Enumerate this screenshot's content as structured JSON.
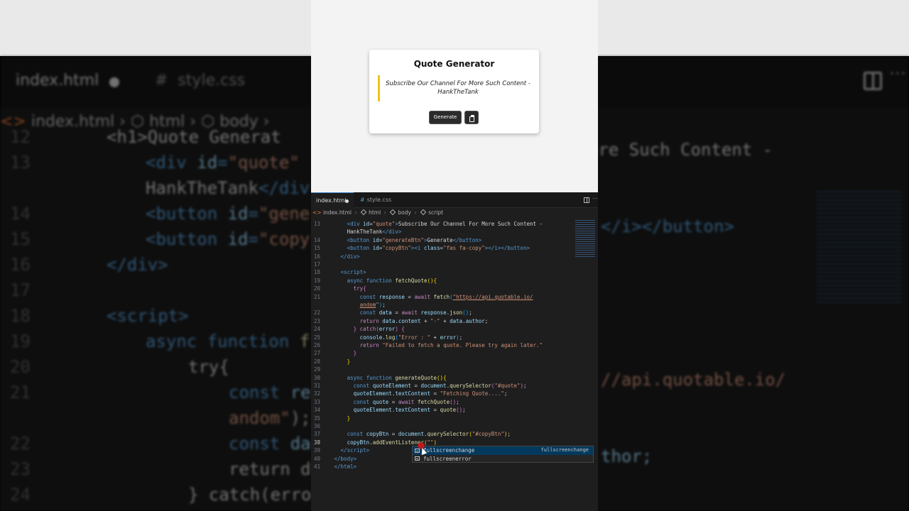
{
  "preview": {
    "title": "Quote Generator",
    "quote": "Subscribe Our Channel For More Such Content - HankTheTank",
    "generate_label": "Generate"
  },
  "editor": {
    "tabs": [
      {
        "label": "index.html",
        "modified": true
      },
      {
        "label": "style.css",
        "icon": "#"
      }
    ],
    "breadcrumb": [
      "index.html",
      "html",
      "body",
      "script"
    ],
    "current_line": 38,
    "lines": [
      {
        "n": 13,
        "html": "<span class=\"t-tag\">&lt;div</span> <span class=\"t-att\">id</span>=<span class=\"t-str\">\"quote\"</span><span class=\"t-tag\">&gt;</span><span class=\"t-txt\">Subscribe Our Channel For More Such Content -</span>",
        "indent": 5
      },
      {
        "n": null,
        "html": "<span class=\"t-txt\">HankTheTank</span><span class=\"t-tag\">&lt;/div&gt;</span>",
        "indent": 5
      },
      {
        "n": 14,
        "html": "<span class=\"t-tag\">&lt;button</span> <span class=\"t-att\">id</span>=<span class=\"t-str\">\"generateBtn\"</span><span class=\"t-tag\">&gt;</span><span class=\"t-txt\">Generate</span><span class=\"t-tag\">&lt;/button&gt;</span>",
        "indent": 5
      },
      {
        "n": 15,
        "html": "<span class=\"t-tag\">&lt;button</span> <span class=\"t-att\">id</span>=<span class=\"t-str\">\"copyBtn\"</span><span class=\"t-tag\">&gt;&lt;i</span> <span class=\"t-att\">class</span>=<span class=\"t-str\">\"fas fa-copy\"</span><span class=\"t-tag\">&gt;&lt;/i&gt;&lt;/button&gt;</span>",
        "indent": 5
      },
      {
        "n": 16,
        "html": "<span class=\"t-tag\">&lt;/div&gt;</span>",
        "indent": 3
      },
      {
        "n": 17,
        "html": "",
        "indent": 0
      },
      {
        "n": 18,
        "html": "<span class=\"t-tag\">&lt;script&gt;</span>",
        "indent": 3
      },
      {
        "n": 19,
        "html": "<span class=\"t-kw\">async</span> <span class=\"t-kw\">function</span> <span class=\"t-fn\">fetchQuote</span><span class=\"t-br\">()</span><span class=\"t-br\">{</span>",
        "indent": 5
      },
      {
        "n": 20,
        "html": "<span class=\"t-ctl\">try</span><span class=\"t-br2\">{</span>",
        "indent": 7
      },
      {
        "n": 21,
        "html": "<span class=\"t-kw\">const</span> <span class=\"t-var\">response</span> = <span class=\"t-ctl\">await</span> <span class=\"t-fn\">fetch</span><span class=\"t-br3\">(</span><span class=\"t-url\">\"https://api.quotable.io/</span>",
        "indent": 9
      },
      {
        "n": null,
        "html": "<span class=\"t-url\">andom</span><span class=\"t-str\">\"</span><span class=\"t-br3\">)</span>;",
        "indent": 9
      },
      {
        "n": 22,
        "html": "<span class=\"t-kw\">const</span> <span class=\"t-var\">data</span> = <span class=\"t-ctl\">await</span> <span class=\"t-var\">response</span>.<span class=\"t-fn\">json</span><span class=\"t-br3\">()</span>;",
        "indent": 9
      },
      {
        "n": 23,
        "html": "<span class=\"t-ctl\">return</span> <span class=\"t-var\">data</span>.<span class=\"t-var\">content</span> + <span class=\"t-str\">\"-\"</span> + <span class=\"t-var\">data</span>.<span class=\"t-var\">author</span>;",
        "indent": 9
      },
      {
        "n": 24,
        "html": "<span class=\"t-br2\">}</span> <span class=\"t-ctl\">catch</span><span class=\"t-br2\">(</span><span class=\"t-var\">error</span><span class=\"t-br2\">)</span> <span class=\"t-br2\">{</span>",
        "indent": 7
      },
      {
        "n": 25,
        "html": "<span class=\"t-var\">console</span>.<span class=\"t-fn\">log</span><span class=\"t-br3\">(</span><span class=\"t-str\">\"Error : \"</span> + <span class=\"t-var\">error</span><span class=\"t-br3\">)</span>;",
        "indent": 9
      },
      {
        "n": 26,
        "html": "<span class=\"t-ctl\">return</span> <span class=\"t-str\">\"Failed to fetch a quote. Please try again later.\"</span>",
        "indent": 9
      },
      {
        "n": 27,
        "html": "<span class=\"t-br2\">}</span>",
        "indent": 7
      },
      {
        "n": 28,
        "html": "<span class=\"t-br\">}</span>",
        "indent": 5
      },
      {
        "n": 29,
        "html": "",
        "indent": 0
      },
      {
        "n": 30,
        "html": "<span class=\"t-kw\">async</span> <span class=\"t-kw\">function</span> <span class=\"t-fn\">generateQuote</span><span class=\"t-br\">()</span><span class=\"t-br\">{</span>",
        "indent": 5
      },
      {
        "n": 31,
        "html": "<span class=\"t-kw\">const</span> <span class=\"t-var\">quoteElement</span> = <span class=\"t-var\">document</span>.<span class=\"t-fn\">querySelector</span><span class=\"t-br2\">(</span><span class=\"t-str\">\"#quote\"</span><span class=\"t-br2\">)</span>;",
        "indent": 7
      },
      {
        "n": 32,
        "html": "<span class=\"t-var\">quoteElement</span>.<span class=\"t-var\">textContent</span> = <span class=\"t-str\">\"Fetching Quote....\"</span>;",
        "indent": 7
      },
      {
        "n": 33,
        "html": "<span class=\"t-kw\">const</span> <span class=\"t-var\">quote</span> = <span class=\"t-ctl\">await</span> <span class=\"t-fn\">fetchQuote</span><span class=\"t-br2\">()</span>;",
        "indent": 7
      },
      {
        "n": 34,
        "html": "<span class=\"t-var\">quoteElement</span>.<span class=\"t-var\">textContent</span> = <span class=\"t-fn\">quote</span><span class=\"t-br2\">()</span>;",
        "indent": 7
      },
      {
        "n": 35,
        "html": "<span class=\"t-br\">}</span>",
        "indent": 5
      },
      {
        "n": 36,
        "html": "",
        "indent": 0
      },
      {
        "n": 37,
        "html": "<span class=\"t-kw\">const</span> <span class=\"t-var\">copyBtn</span> = <span class=\"t-var\">document</span>.<span class=\"t-fn\">querySelector</span><span class=\"t-br\">(</span><span class=\"t-str\">\"#copyBtn\"</span><span class=\"t-br\">)</span>;",
        "indent": 5
      },
      {
        "n": 38,
        "html": "<span class=\"t-var\">copyBtn</span>.<span class=\"t-fn\">addEventListener</span><span class=\"t-br\">(</span><span class=\"t-str\">\"\"</span><span class=\"t-br\">)</span>",
        "indent": 5
      },
      {
        "n": 39,
        "html": "<span class=\"t-tag\">&lt;/script&gt;</span>",
        "indent": 3
      },
      {
        "n": 40,
        "html": "<span class=\"t-tag\">&lt;/body&gt;</span>",
        "indent": 1
      },
      {
        "n": 41,
        "html": "<span class=\"t-tag\">&lt;/html&gt;</span>",
        "indent": 1
      }
    ],
    "autocomplete": {
      "items": [
        "fullscreenchange",
        "fullscreenerror"
      ],
      "detail": "fullscreenchange"
    }
  },
  "background": {
    "tabs": [
      "index.html",
      "style.css"
    ],
    "breadcrumb": [
      "index.html",
      "html",
      "body"
    ],
    "lines": [
      {
        "n": "12",
        "html": "<span class=\"w\">&lt;h1&gt;Quote Generat</span>"
      },
      {
        "n": "13",
        "html": "&lt;div <span class=\"v\">id</span>=<span class=\"s\">\"quote\"</span>"
      },
      {
        "n": "",
        "html": "<span class=\"w\">HankTheTank</span>&lt;/div"
      },
      {
        "n": "14",
        "html": "&lt;button <span class=\"v\">id</span>=<span class=\"s\">\"gene</span>"
      },
      {
        "n": "15",
        "html": "&lt;button <span class=\"v\">id</span>=<span class=\"s\">\"copy</span>"
      },
      {
        "n": "16",
        "html": "&lt;/div&gt;"
      },
      {
        "n": "17",
        "html": ""
      },
      {
        "n": "18",
        "html": "&lt;script&gt;"
      },
      {
        "n": "19",
        "html": "async function <span class=\"y\">f</span>"
      },
      {
        "n": "20",
        "html": "<span class=\"w\">try{</span>"
      },
      {
        "n": "21",
        "html": "const <span class=\"v\">re</span>"
      },
      {
        "n": "",
        "html": "<span class=\"s\">andom\"</span><span class=\"w\">);</span>"
      },
      {
        "n": "22",
        "html": "const <span class=\"v\">da</span>"
      },
      {
        "n": "23",
        "html": "<span class=\"w\">return d</span>"
      },
      {
        "n": "24",
        "html": "<span class=\"w\">} catch(erro</span>"
      }
    ],
    "right_texts": [
      {
        "html": "<span class=\"w\">ore Such Content -</span>"
      },
      {
        "html": "&lt;/i&gt;&lt;/button&gt;"
      },
      {
        "html": "<span class=\"s\">//api.quotable.io/</span>"
      },
      {
        "html": "<span class=\"v\">thor;</span>"
      }
    ]
  }
}
